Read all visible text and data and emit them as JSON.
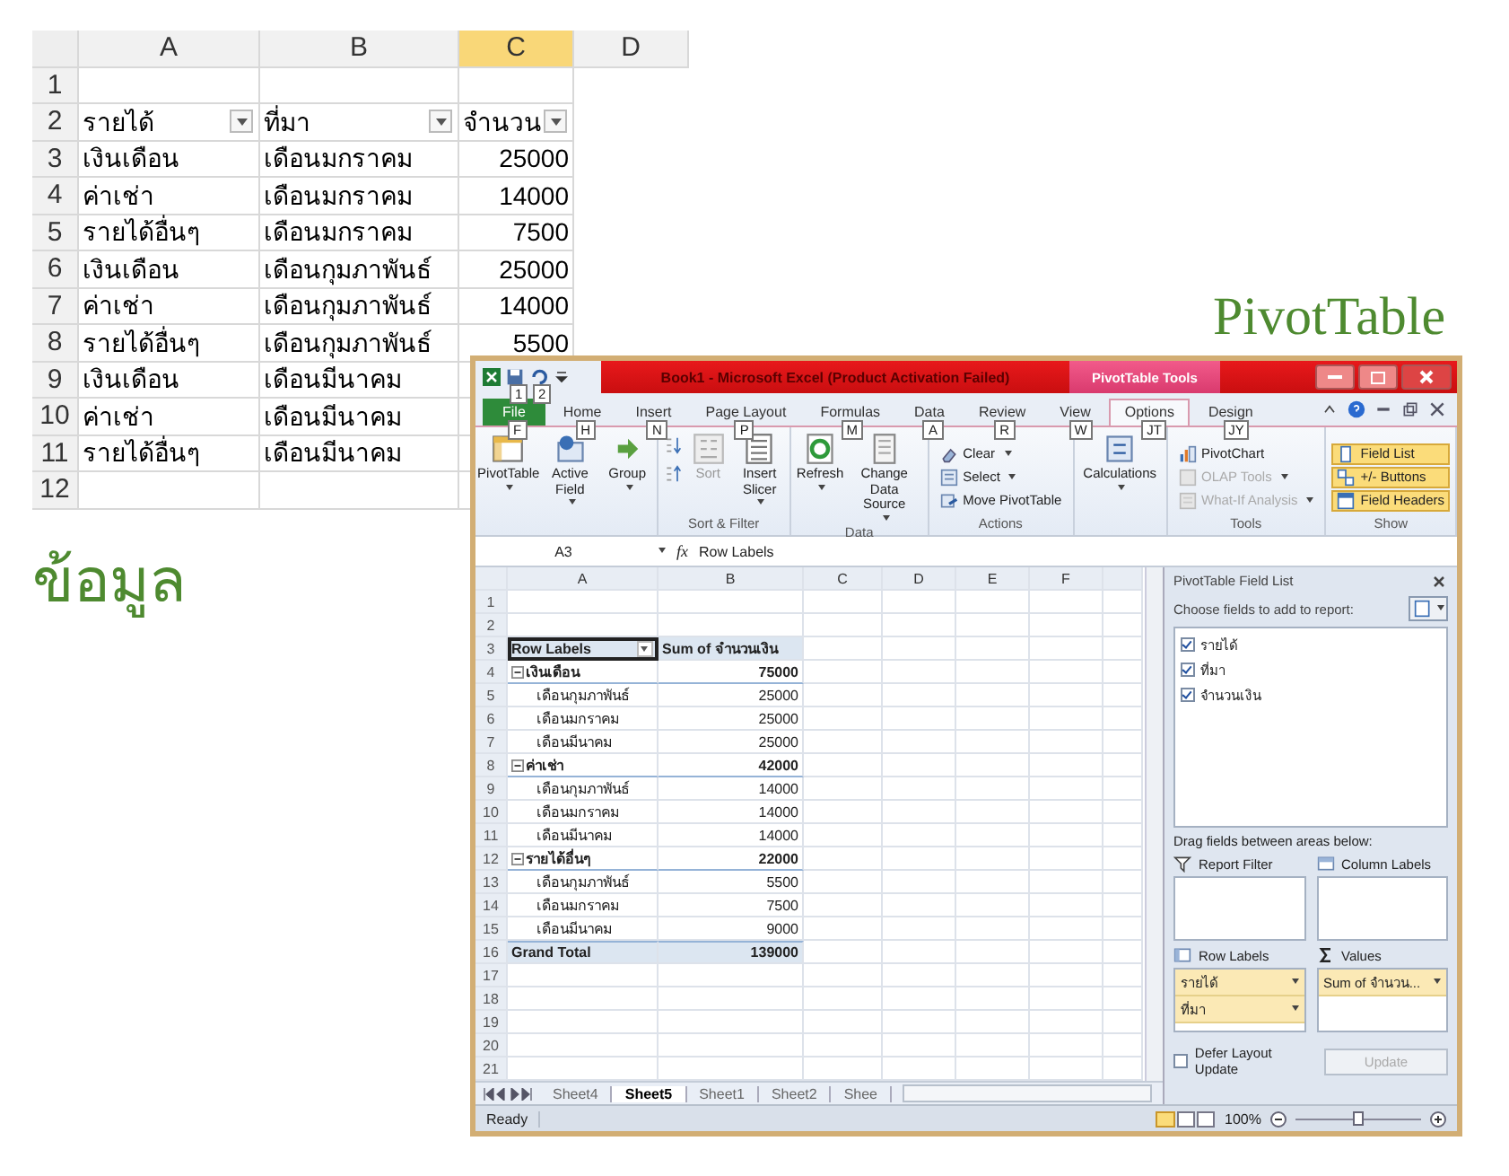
{
  "data_sheet": {
    "columns": [
      {
        "label": "A",
        "selected": false
      },
      {
        "label": "B",
        "selected": false
      },
      {
        "label": "C",
        "selected": true
      },
      {
        "label": "D",
        "selected": false
      }
    ],
    "rows": [
      {
        "number": "1"
      },
      {
        "number": "2",
        "cells": [
          {
            "text": "รายได้",
            "kind": "text",
            "filter": true
          },
          {
            "text": "ที่มา",
            "kind": "text",
            "filter": true
          },
          {
            "text": "จำนวน",
            "kind": "text",
            "filter": true
          }
        ]
      },
      {
        "number": "3",
        "cells": [
          {
            "text": "เงินเดือน",
            "kind": "text"
          },
          {
            "text": "เดือนมกราคม",
            "kind": "text"
          },
          {
            "text": "25000",
            "kind": "number"
          }
        ]
      },
      {
        "number": "4",
        "cells": [
          {
            "text": "ค่าเช่า",
            "kind": "text"
          },
          {
            "text": "เดือนมกราคม",
            "kind": "text"
          },
          {
            "text": "14000",
            "kind": "number"
          }
        ]
      },
      {
        "number": "5",
        "cells": [
          {
            "text": "รายได้อื่นๆ",
            "kind": "text"
          },
          {
            "text": "เดือนมกราคม",
            "kind": "text"
          },
          {
            "text": "7500",
            "kind": "number"
          }
        ]
      },
      {
        "number": "6",
        "cells": [
          {
            "text": "เงินเดือน",
            "kind": "text"
          },
          {
            "text": "เดือนกุมภาพันธ์",
            "kind": "text"
          },
          {
            "text": "25000",
            "kind": "number"
          }
        ]
      },
      {
        "number": "7",
        "cells": [
          {
            "text": "ค่าเช่า",
            "kind": "text"
          },
          {
            "text": "เดือนกุมภาพันธ์",
            "kind": "text"
          },
          {
            "text": "14000",
            "kind": "number"
          }
        ]
      },
      {
        "number": "8",
        "cells": [
          {
            "text": "รายได้อื่นๆ",
            "kind": "text"
          },
          {
            "text": "เดือนกุมภาพันธ์",
            "kind": "text"
          },
          {
            "text": "5500",
            "kind": "number"
          }
        ]
      },
      {
        "number": "9",
        "cells": [
          {
            "text": "เงินเดือน",
            "kind": "text"
          },
          {
            "text": "เดือนมีนาคม",
            "kind": "text"
          }
        ]
      },
      {
        "number": "10",
        "cells": [
          {
            "text": "ค่าเช่า",
            "kind": "text"
          },
          {
            "text": "เดือนมีนาคม",
            "kind": "text"
          }
        ]
      },
      {
        "number": "11",
        "cells": [
          {
            "text": "รายได้อื่นๆ",
            "kind": "text"
          },
          {
            "text": "เดือนมีนาคม",
            "kind": "text"
          }
        ]
      },
      {
        "number": "12"
      }
    ]
  },
  "caption_data": "ข้อมูล",
  "caption_pivot": "PivotTable",
  "excel_window": {
    "qat_keytips": [
      "1",
      "2"
    ],
    "title": "Book1 - Microsoft Excel (Product Activation Failed)",
    "context_tab": "PivotTable Tools",
    "tabs": [
      {
        "label": "File",
        "keytip": "F",
        "kind": "file",
        "selected": false
      },
      {
        "label": "Home",
        "keytip": "H",
        "kind": "normal",
        "selected": false
      },
      {
        "label": "Insert",
        "keytip": "N",
        "kind": "normal",
        "selected": false
      },
      {
        "label": "Page Layout",
        "keytip": "P",
        "kind": "normal",
        "selected": false
      },
      {
        "label": "Formulas",
        "keytip": "M",
        "kind": "normal",
        "selected": false
      },
      {
        "label": "Data",
        "keytip": "A",
        "kind": "normal",
        "selected": false
      },
      {
        "label": "Review",
        "keytip": "R",
        "kind": "normal",
        "selected": false
      },
      {
        "label": "View",
        "keytip": "W",
        "kind": "normal",
        "selected": false
      },
      {
        "label": "Options",
        "keytip": "JT",
        "kind": "context",
        "selected": true
      },
      {
        "label": "Design",
        "keytip": "JY",
        "kind": "context",
        "selected": false
      }
    ],
    "ribbon_groups": [
      {
        "buttons": [
          {
            "label": "PivotTable",
            "kind": "large",
            "dropdown": true
          },
          {
            "label": "Active Field",
            "kind": "large",
            "dropdown": true
          },
          {
            "label": "Group",
            "kind": "large",
            "dropdown": true
          }
        ]
      },
      {
        "label": "Sort & Filter",
        "buttons": [
          {
            "kind": "icons"
          },
          {
            "label": "Sort",
            "kind": "large",
            "disabled": true
          },
          {
            "label": "Insert Slicer",
            "kind": "large",
            "dropdown": true
          }
        ]
      },
      {
        "label": "Data",
        "buttons": [
          {
            "label": "Refresh",
            "kind": "large",
            "dropdown": true
          },
          {
            "label": "Change Data Source",
            "kind": "large",
            "dropdown": true
          }
        ]
      },
      {
        "label": "Actions",
        "buttons": [
          {
            "label": "Clear",
            "kind": "small",
            "dropdown": true
          },
          {
            "label": "Select",
            "kind": "small",
            "dropdown": true
          },
          {
            "label": "Move PivotTable",
            "kind": "small"
          }
        ]
      },
      {
        "buttons": [
          {
            "label": "Calculations",
            "kind": "large",
            "dropdown": true
          }
        ]
      },
      {
        "label": "Tools",
        "buttons": [
          {
            "label": "PivotChart",
            "kind": "small",
            "disabled": false
          },
          {
            "label": "OLAP Tools",
            "kind": "small",
            "dropdown": true,
            "disabled": true
          },
          {
            "label": "What-If Analysis",
            "kind": "small",
            "dropdown": true,
            "disabled": true
          }
        ]
      },
      {
        "label": "Show",
        "buttons": [
          {
            "label": "Field List",
            "kind": "small",
            "on": true
          },
          {
            "label": "+/- Buttons",
            "kind": "small",
            "on": true
          },
          {
            "label": "Field Headers",
            "kind": "small",
            "on": true
          }
        ]
      }
    ],
    "name_box": "A3",
    "function_label": "fx",
    "formula": "Row Labels",
    "grid_columns": [
      "A",
      "B",
      "C",
      "D",
      "E",
      "F"
    ],
    "pivot_rows": [
      {
        "number": "1",
        "kind": "empty"
      },
      {
        "number": "2",
        "kind": "empty"
      },
      {
        "number": "3",
        "kind": "header",
        "label": "Row Labels",
        "value": "Sum of จำนวนเงิน"
      },
      {
        "number": "4",
        "kind": "group",
        "label": "เงินเดือน",
        "value": "75000",
        "expanded": true
      },
      {
        "number": "5",
        "kind": "item",
        "label": "เดือนกุมภาพันธ์",
        "value": "25000"
      },
      {
        "number": "6",
        "kind": "item",
        "label": "เดือนมกราคม",
        "value": "25000"
      },
      {
        "number": "7",
        "kind": "item",
        "label": "เดือนมีนาคม",
        "value": "25000"
      },
      {
        "number": "8",
        "kind": "group",
        "label": "ค่าเช่า",
        "value": "42000",
        "expanded": true
      },
      {
        "number": "9",
        "kind": "item",
        "label": "เดือนกุมภาพันธ์",
        "value": "14000"
      },
      {
        "number": "10",
        "kind": "item",
        "label": "เดือนมกราคม",
        "value": "14000"
      },
      {
        "number": "11",
        "kind": "item",
        "label": "เดือนมีนาคม",
        "value": "14000"
      },
      {
        "number": "12",
        "kind": "group",
        "label": "รายได้อื่นๆ",
        "value": "22000",
        "expanded": true
      },
      {
        "number": "13",
        "kind": "item",
        "label": "เดือนกุมภาพันธ์",
        "value": "5500"
      },
      {
        "number": "14",
        "kind": "item",
        "label": "เดือนมกราคม",
        "value": "7500"
      },
      {
        "number": "15",
        "kind": "item",
        "label": "เดือนมีนาคม",
        "value": "9000"
      },
      {
        "number": "16",
        "kind": "total",
        "label": "Grand Total",
        "value": "139000"
      },
      {
        "number": "17",
        "kind": "empty"
      },
      {
        "number": "18",
        "kind": "empty"
      },
      {
        "number": "19",
        "kind": "empty"
      },
      {
        "number": "20",
        "kind": "empty"
      },
      {
        "number": "21",
        "kind": "empty"
      }
    ],
    "sheet_tabs": [
      {
        "label": "Sheet4",
        "selected": false
      },
      {
        "label": "Sheet5",
        "selected": true
      },
      {
        "label": "Sheet1",
        "selected": false
      },
      {
        "label": "Sheet2",
        "selected": false
      },
      {
        "label": "Shee",
        "selected": false
      }
    ],
    "status": "Ready",
    "zoom": "100%",
    "zoom_slider": {
      "level": 0.5
    },
    "field_list": {
      "title": "PivotTable Field List",
      "prompt": "Choose fields to add to report:",
      "fields": [
        {
          "label": "รายได้",
          "checked": true
        },
        {
          "label": "ที่มา",
          "checked": true
        },
        {
          "label": "จำนวนเงิน",
          "checked": true
        }
      ],
      "areas_prompt": "Drag fields between areas below:",
      "areas": [
        {
          "label": "Report Filter"
        },
        {
          "label": "Column Labels"
        },
        {
          "label": "Row Labels",
          "items": [
            "รายได้",
            "ที่มา"
          ]
        },
        {
          "label": "Values",
          "items": [
            "Sum of จำนวน..."
          ]
        }
      ],
      "defer": {
        "label": "Defer Layout Update",
        "checked": false
      },
      "update": {
        "label": "Update",
        "disabled": true
      }
    }
  }
}
